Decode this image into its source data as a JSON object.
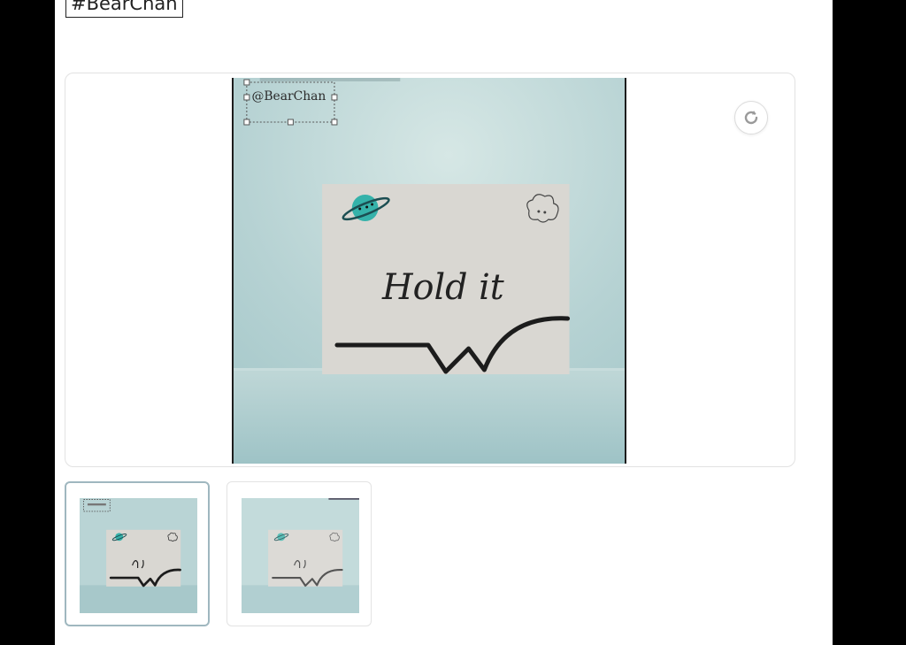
{
  "post": {
    "hashtag": "#BearChan"
  },
  "image": {
    "watermark_text": "@BearChan",
    "card_text": "Hold it",
    "background_color": "#b7d3d4",
    "card_color": "#d8d6d1",
    "planet_color": "#39b5ad"
  },
  "controls": {
    "rotate_icon": "rotate-icon"
  },
  "thumbnails": {
    "selected_index": 0,
    "count": 2
  }
}
